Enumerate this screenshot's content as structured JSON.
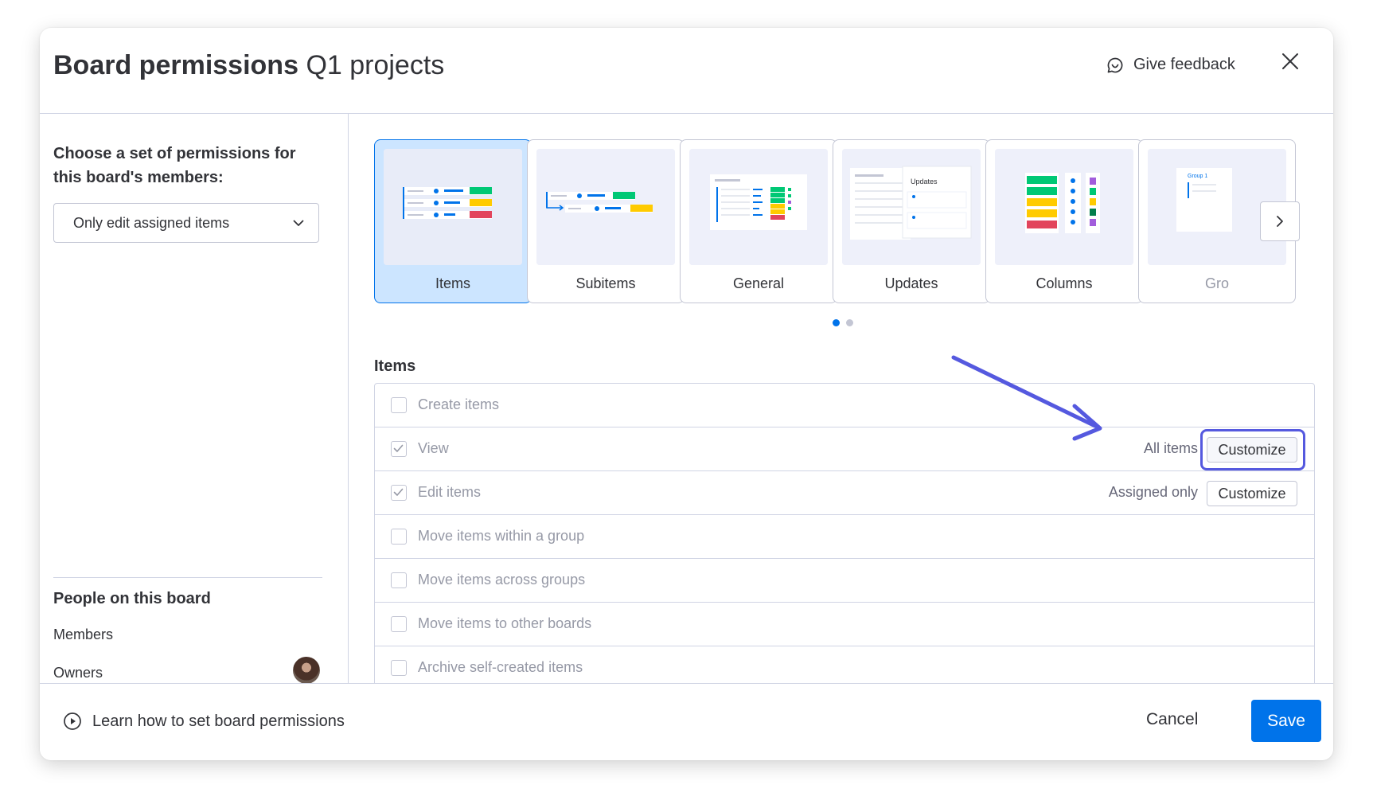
{
  "header": {
    "title_bold": "Board permissions",
    "title_sub": "Q1 projects",
    "feedback_label": "Give feedback",
    "feedback_icon": "chat-bubble-icon",
    "close_icon": "close-icon"
  },
  "sidebar": {
    "choose_label": "Choose a set of permissions for this board's members:",
    "select_value": "Only edit assigned items",
    "people_title": "People on this board",
    "members_label": "Members",
    "owners_label": "Owners"
  },
  "cards": [
    {
      "label": "Items",
      "active": true
    },
    {
      "label": "Subitems"
    },
    {
      "label": "General"
    },
    {
      "label": "Updates",
      "thumb_text": "Updates"
    },
    {
      "label": "Columns"
    },
    {
      "label": "Gro",
      "thumb_text": "Group 1"
    }
  ],
  "pagination": {
    "pages": 2,
    "current": 1
  },
  "section": {
    "title": "Items",
    "rows": [
      {
        "label": "Create items",
        "checked": false
      },
      {
        "label": "View",
        "checked": true,
        "value": "All items",
        "button": "Customize",
        "highlighted": true
      },
      {
        "label": "Edit items",
        "checked": true,
        "value": "Assigned only",
        "button": "Customize"
      },
      {
        "label": "Move items within a group",
        "checked": false
      },
      {
        "label": "Move items across groups",
        "checked": false
      },
      {
        "label": "Move items to other boards",
        "checked": false
      },
      {
        "label": "Archive self-created items",
        "checked": false
      }
    ]
  },
  "footer": {
    "learn_label": "Learn how to set board permissions",
    "learn_icon": "play-circle-icon",
    "cancel_label": "Cancel",
    "save_label": "Save"
  },
  "colors": {
    "accent": "#0073ea",
    "highlight": "#5559df",
    "green": "#00c875",
    "yellow": "#ffcb00",
    "red": "#e2445c",
    "purple": "#a25ddc"
  }
}
